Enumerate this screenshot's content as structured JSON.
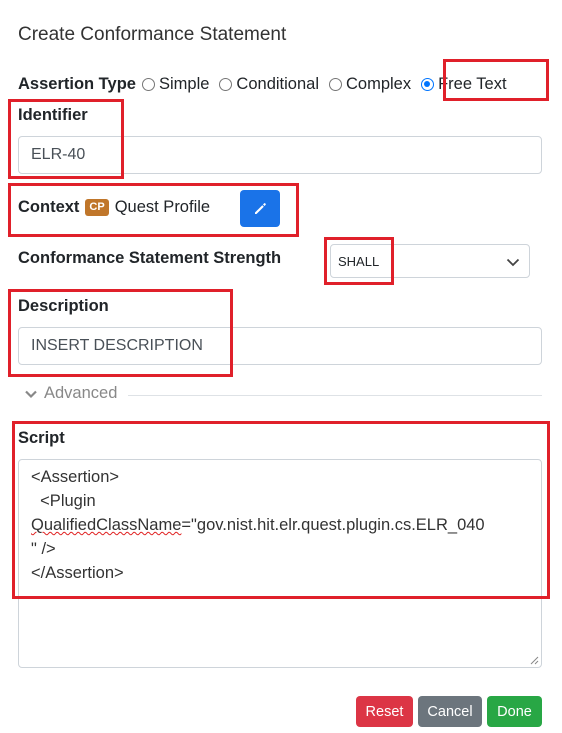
{
  "modal": {
    "title": "Create Conformance Statement"
  },
  "assertion_type": {
    "label": "Assertion Type",
    "options": [
      {
        "label": "Simple",
        "checked": false
      },
      {
        "label": "Conditional",
        "checked": false
      },
      {
        "label": "Complex",
        "checked": false
      },
      {
        "label": "Free Text",
        "checked": true
      }
    ]
  },
  "identifier": {
    "label": "Identifier",
    "value": "ELR-40"
  },
  "context": {
    "label": "Context",
    "badge": "CP",
    "value": "Quest Profile",
    "edit_icon": "pencil-icon"
  },
  "strength": {
    "label": "Conformance Statement Strength",
    "selected": "SHALL"
  },
  "description": {
    "label": "Description",
    "value": "INSERT DESCRIPTION"
  },
  "advanced": {
    "label": "Advanced",
    "icon": "chevron-down-icon"
  },
  "script": {
    "label": "Script",
    "line1": "<Assertion>",
    "line2": "  <Plugin",
    "line3_attr": "QualifiedClassName",
    "line3_rest": "=\"gov.nist.hit.elr.quest.plugin.cs.ELR_040",
    "line4": "\" />",
    "line5": "</Assertion>"
  },
  "buttons": {
    "reset": "Reset",
    "cancel": "Cancel",
    "done": "Done"
  },
  "colors": {
    "highlight": "#e0202a",
    "badge": "#c0762a",
    "edit_button": "#1a73e8",
    "reset": "#dc3545",
    "cancel": "#6c757d",
    "done": "#28a745"
  }
}
